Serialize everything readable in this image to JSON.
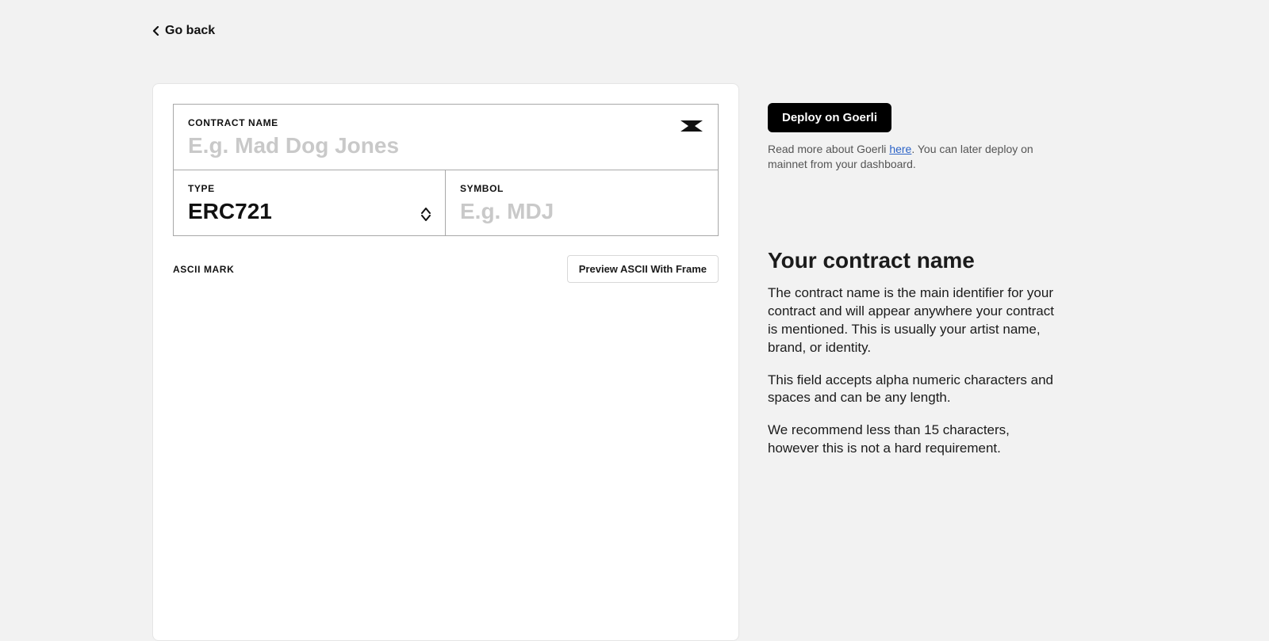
{
  "nav": {
    "go_back": "Go back"
  },
  "form": {
    "contract_name": {
      "label": "CONTRACT NAME",
      "placeholder": "E.g. Mad Dog Jones",
      "value": ""
    },
    "type": {
      "label": "TYPE",
      "value": "ERC721"
    },
    "symbol": {
      "label": "SYMBOL",
      "placeholder": "E.g. MDJ",
      "value": ""
    },
    "ascii": {
      "label": "ASCII MARK",
      "preview_button": "Preview ASCII With Frame"
    }
  },
  "sidebar": {
    "deploy_button_label": "Deploy on Goerli",
    "note_prefix": "Read more about Goerli ",
    "note_link_text": "here",
    "note_suffix": ". You can later deploy on mainnet from your dashboard.",
    "heading": "Your contract name",
    "para1": "The contract name is the main identifier for your contract and will appear anywhere your contract is mentioned. This is usually your artist name, brand, or identity.",
    "para2": "This field accepts alpha numeric characters and spaces and can be any length.",
    "para3": "We recommend less than 15 characters, however this is not a hard requirement."
  }
}
